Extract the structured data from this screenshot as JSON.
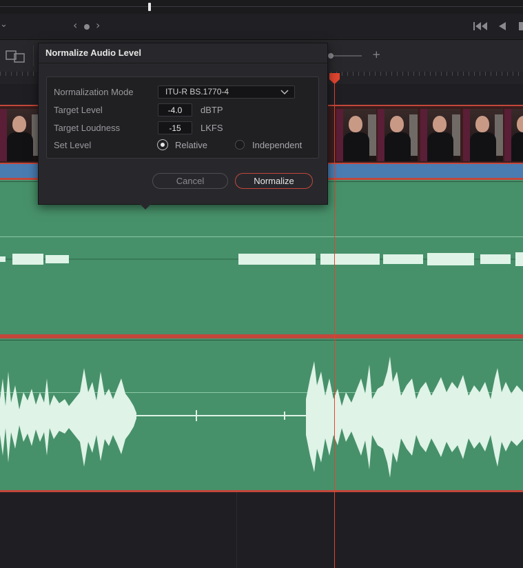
{
  "nav": {
    "left_chevron": "‹",
    "right_chevron": "›",
    "dropdown_glyph": "⌄"
  },
  "toolbar": {
    "zoom_plus": "+"
  },
  "dialog": {
    "title": "Normalize Audio Level",
    "fields": {
      "mode_label": "Normalization Mode",
      "mode_value": "ITU-R BS.1770-4",
      "target_level_label": "Target Level",
      "target_level_value": "-4.0",
      "target_level_unit": "dBTP",
      "target_loudness_label": "Target Loudness",
      "target_loudness_value": "-15",
      "target_loudness_unit": "LKFS",
      "set_level_label": "Set Level",
      "relative_label": "Relative",
      "independent_label": "Independent"
    },
    "buttons": {
      "cancel": "Cancel",
      "normalize": "Normalize"
    },
    "selected_set_level": "Relative"
  },
  "colors": {
    "playhead": "#e0452f",
    "audio_clip": "#47916a",
    "clip_border": "#c4473b",
    "video_clip_bar": "#4a7cb1"
  }
}
